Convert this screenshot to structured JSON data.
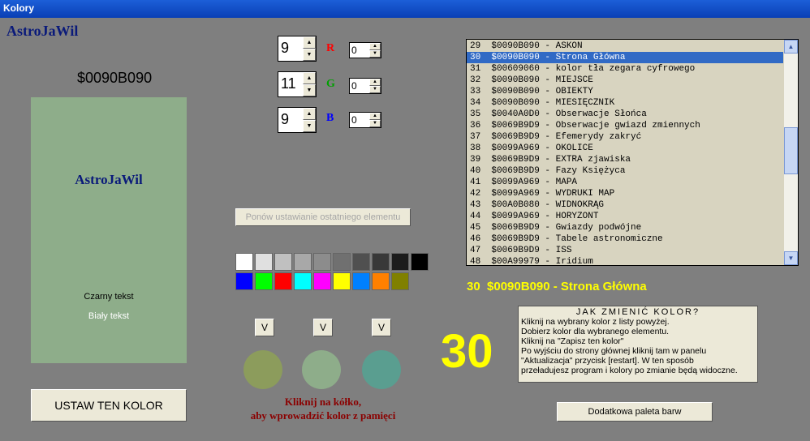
{
  "window": {
    "title": "Kolory"
  },
  "brand": "AstroJaWil",
  "hex_label": "$0090B090",
  "preview": {
    "color": "#8ead8a",
    "title": "AstroJaWil",
    "black_text": "Czarny tekst",
    "white_text": "Biały tekst"
  },
  "buttons": {
    "set_color": "USTAW TEN KOLOR",
    "restore": "Ponów ustawianie ostatniego elementu",
    "extra_palette": "Dodatkowa paleta barw",
    "v": "V"
  },
  "rgb": {
    "r": {
      "label": "R",
      "value": "9",
      "small": "0",
      "color": "#ff0000"
    },
    "g": {
      "label": "G",
      "value": "11",
      "small": "0",
      "color": "#00a000"
    },
    "b": {
      "label": "B",
      "value": "9",
      "small": "0",
      "color": "#0000ff"
    }
  },
  "swatches": {
    "row1": [
      "#ffffff",
      "#e0e0e0",
      "#c0c0c0",
      "#a8a8a8",
      "#8c8c8c",
      "#707070",
      "#505050",
      "#383838",
      "#1c1c1c",
      "#000000"
    ],
    "row2": [
      "#0000ff",
      "#00ff00",
      "#ff0000",
      "#00ffff",
      "#ff00ff",
      "#ffff00",
      "#0080ff",
      "#ff8000",
      "#808000"
    ]
  },
  "memory_circles": [
    "#8c9c5c",
    "#8ead8a",
    "#5a9e90"
  ],
  "memory_hint": [
    "Kliknij na kółko,",
    "aby wprowadzić kolor z pamięci"
  ],
  "list": {
    "items": [
      "29  $0090B090 - ASKON",
      "30  $0090B090 - Strona Główna",
      "31  $00609060 - kolor tła zegara cyfrowego",
      "32  $0090B090 - MIEJSCE",
      "33  $0090B090 - OBIEKTY",
      "34  $0090B090 - MIESIĘCZNIK",
      "35  $0040A0D0 - Obserwacje Słońca",
      "36  $0069B9D9 - Obserwacje gwiazd zmiennych",
      "37  $0069B9D9 - Efemerydy zakryć",
      "38  $0099A969 - OKOLICE",
      "39  $0069B9D9 - EXTRA zjawiska",
      "40  $0069B9D9 - Fazy Księżyca",
      "41  $0099A969 - MAPA",
      "42  $0099A969 - WYDRUKI MAP",
      "43  $00A0B080 - WIDNOKRĄG",
      "44  $0099A969 - HORYZONT",
      "45  $0069B9D9 - Gwiazdy podwójne",
      "46  $0069B9D9 - Tabele astronomiczne",
      "47  $0069B9D9 - ISS",
      "48  $00A99979 - Iridium"
    ],
    "selected_index": 1
  },
  "selected_text": "30  $0090B090 - Strona Główna",
  "big_number": "30",
  "howto": {
    "title": "JAK ZMIENIĆ KOLOR?",
    "lines": [
      "Kliknij na wybrany kolor z listy powyżej.",
      "Dobierz kolor dla wybranego elementu.",
      "Kliknij na \"Zapisz ten kolor\"",
      "Po wyjściu do strony głównej kliknij tam w panelu",
      "\"Aktualizacja\" przycisk [restart]. W ten sposób",
      "przeładujesz program i kolory po zmianie będą widoczne."
    ]
  }
}
